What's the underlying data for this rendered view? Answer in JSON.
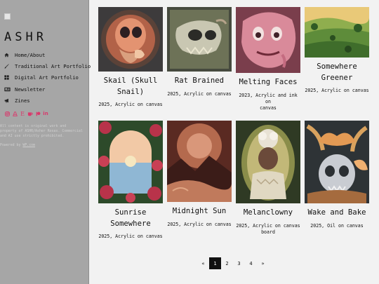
{
  "site": {
    "title": "ASHR"
  },
  "nav": [
    {
      "label": "Home/About",
      "icon": "home-icon"
    },
    {
      "label": "Traditional Art Portfolio",
      "icon": "brush-icon"
    },
    {
      "label": "Digital Art Portfolio",
      "icon": "grid-icon"
    },
    {
      "label": "Newsletter",
      "icon": "newspaper-icon"
    },
    {
      "label": "Zines",
      "icon": "megaphone-icon"
    }
  ],
  "social": [
    "instagram-icon",
    "linktree-icon",
    "etsy-icon",
    "kofi-icon",
    "patreon-icon",
    "linkedin-icon"
  ],
  "social_glyphs": {
    "etsy": "E",
    "linkedin": "in"
  },
  "footer": {
    "copyright": "All content is original work and\nproperty of ASHR/Asher Rosas. Commercial\nand AI use strictly prohibited.",
    "powered_prefix": "Powered by ",
    "powered_link": "WP.com"
  },
  "artworks": [
    {
      "title": "Skail (Skull\nSnail)",
      "caption": "2025, Acrylic on canvas"
    },
    {
      "title": "Rat Brained",
      "caption": "2025, Acrylic on canvas"
    },
    {
      "title": "Melting Faces",
      "caption": "2023, Acrylic and ink on\ncanvas"
    },
    {
      "title": "Somewhere\nGreener",
      "caption": "2025, Acrylic on canvas"
    },
    {
      "title": "Sunrise\nSomewhere",
      "caption": "2025, Acrylic on canvas"
    },
    {
      "title": "Midnight Sun",
      "caption": "2025, Acrylic on canvas"
    },
    {
      "title": "Melanclowny",
      "caption": "2025, Acrylic on canvas\nboard"
    },
    {
      "title": "Wake and Bake",
      "caption": "2025, Oil on canvas"
    }
  ],
  "pagination": {
    "prev": "«",
    "pages": [
      "1",
      "2",
      "3",
      "4"
    ],
    "current": "1",
    "next": "»"
  },
  "colors": {
    "sidebar": "#a6a6a6",
    "page": "#f2f2f2",
    "accent": "#d9386b",
    "active_page": "#111111"
  }
}
